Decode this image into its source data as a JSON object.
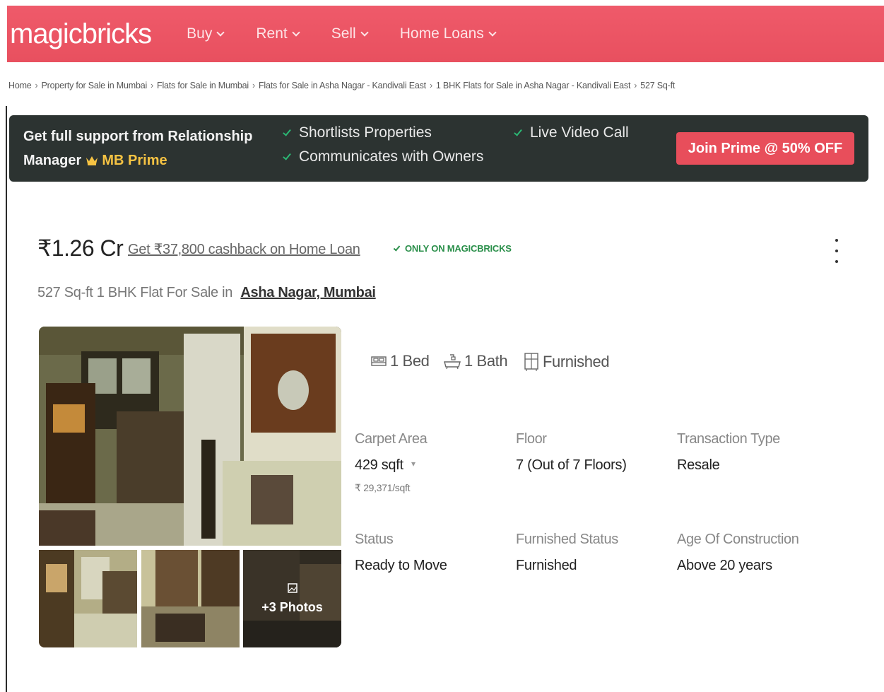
{
  "header": {
    "logo": "magicbricks",
    "nav": [
      {
        "label": "Buy"
      },
      {
        "label": "Rent"
      },
      {
        "label": "Sell"
      },
      {
        "label": "Home Loans"
      }
    ]
  },
  "breadcrumb": [
    "Home",
    "Property for Sale in Mumbai",
    "Flats for Sale in Mumbai",
    "Flats for Sale in Asha Nagar - Kandivali East",
    "1 BHK Flats for Sale in Asha Nagar - Kandivali East",
    "527 Sq-ft"
  ],
  "prime": {
    "title_line1": "Get full support from Relationship",
    "title_line2": "Manager",
    "brand": "MB Prime",
    "features": [
      "Shortlists Properties",
      "Communicates with Owners",
      "Live Video Call"
    ],
    "button": "Join Prime @ 50% OFF"
  },
  "listing": {
    "price": "₹1.26 Cr",
    "cashback": "Get ₹37,800 cashback on Home Loan",
    "badge": "ONLY ON MAGICBRICKS",
    "title": "527 Sq-ft 1 BHK Flat For Sale in",
    "location": "Asha Nagar, Mumbai",
    "more_photos": "+3 Photos",
    "amenities": {
      "bed": "1 Bed",
      "bath": "1 Bath",
      "furnished": "Furnished"
    },
    "details": {
      "carpet_area_label": "Carpet Area",
      "carpet_area_value": "429 sqft",
      "carpet_area_rate": "₹ 29,371/sqft",
      "floor_label": "Floor",
      "floor_value": "7 (Out of 7 Floors)",
      "transaction_label": "Transaction Type",
      "transaction_value": "Resale",
      "status_label": "Status",
      "status_value": "Ready to Move",
      "furnished_label": "Furnished Status",
      "furnished_value": "Furnished",
      "age_label": "Age Of Construction",
      "age_value": "Above 20 years"
    }
  },
  "colors": {
    "header": "#e8505f",
    "banner": "#2c3331",
    "accent": "#e84e5b",
    "prime_gold": "#f6c343",
    "success": "#2a8f4a"
  }
}
